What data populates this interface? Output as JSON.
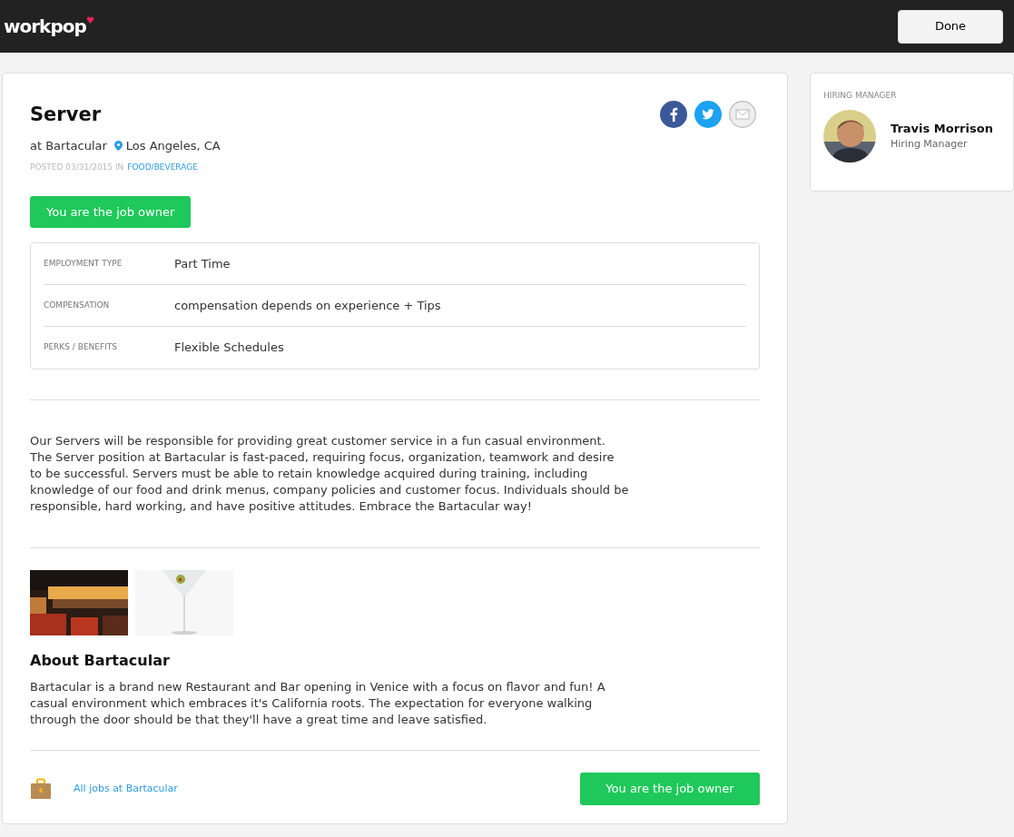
{
  "header": {
    "logo": "workpop",
    "done_button": "Done"
  },
  "job": {
    "title": "Server",
    "company": "at Bartacular",
    "location": "Los Angeles, CA",
    "posted": "POSTED 03/31/2015 IN",
    "category": "FOOD/BEVERAGE",
    "owner_button": "You are the job owner",
    "details": [
      {
        "label": "EMPLOYMENT TYPE",
        "value": "Part Time"
      },
      {
        "label": "COMPENSATION",
        "value": "compensation depends on experience + Tips"
      },
      {
        "label": "PERKS / BENEFITS",
        "value": "Flexible Schedules"
      }
    ],
    "description": "Our Servers will be responsible for providing great customer service in a fun casual environment. The Server position at Bartacular is fast-paced, requiring focus, organization, teamwork and desire to be successful. Servers must be able to retain knowledge acquired during training, including knowledge of our food and drink menus, company policies and customer focus. Individuals should be responsible, hard working, and have positive attitudes. Embrace the Bartacular way!",
    "about_title": "About Bartacular",
    "about_text": "Bartacular is a brand new Restaurant and Bar opening in Venice with a focus on flavor and fun! A casual environment which embraces it's California roots. The expectation for everyone walking through the door should be that they'll have a great time and leave satisfied.",
    "all_jobs_link": "All jobs at Bartacular",
    "footer_owner_button": "You are the job owner"
  },
  "sidebar": {
    "heading": "HIRING MANAGER",
    "name": "Travis Morrison",
    "role": "Hiring Manager"
  }
}
